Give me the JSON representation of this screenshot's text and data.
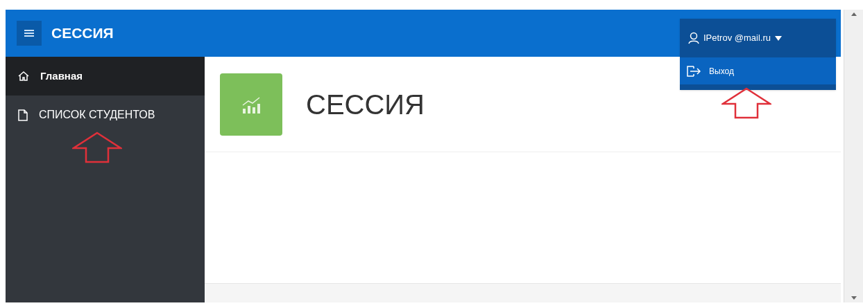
{
  "header": {
    "title": "СЕССИЯ"
  },
  "user_menu": {
    "label": "IPetrov @mail.ru",
    "expanded": true,
    "items": [
      {
        "label": "Выход",
        "selected": true
      }
    ]
  },
  "sidebar": {
    "items": [
      {
        "label": "Главная",
        "selected": true,
        "kind": "home"
      },
      {
        "label": "СПИСОК СТУДЕНТОВ",
        "selected": false,
        "kind": "page"
      }
    ]
  },
  "page": {
    "title": "СЕССИЯ"
  }
}
